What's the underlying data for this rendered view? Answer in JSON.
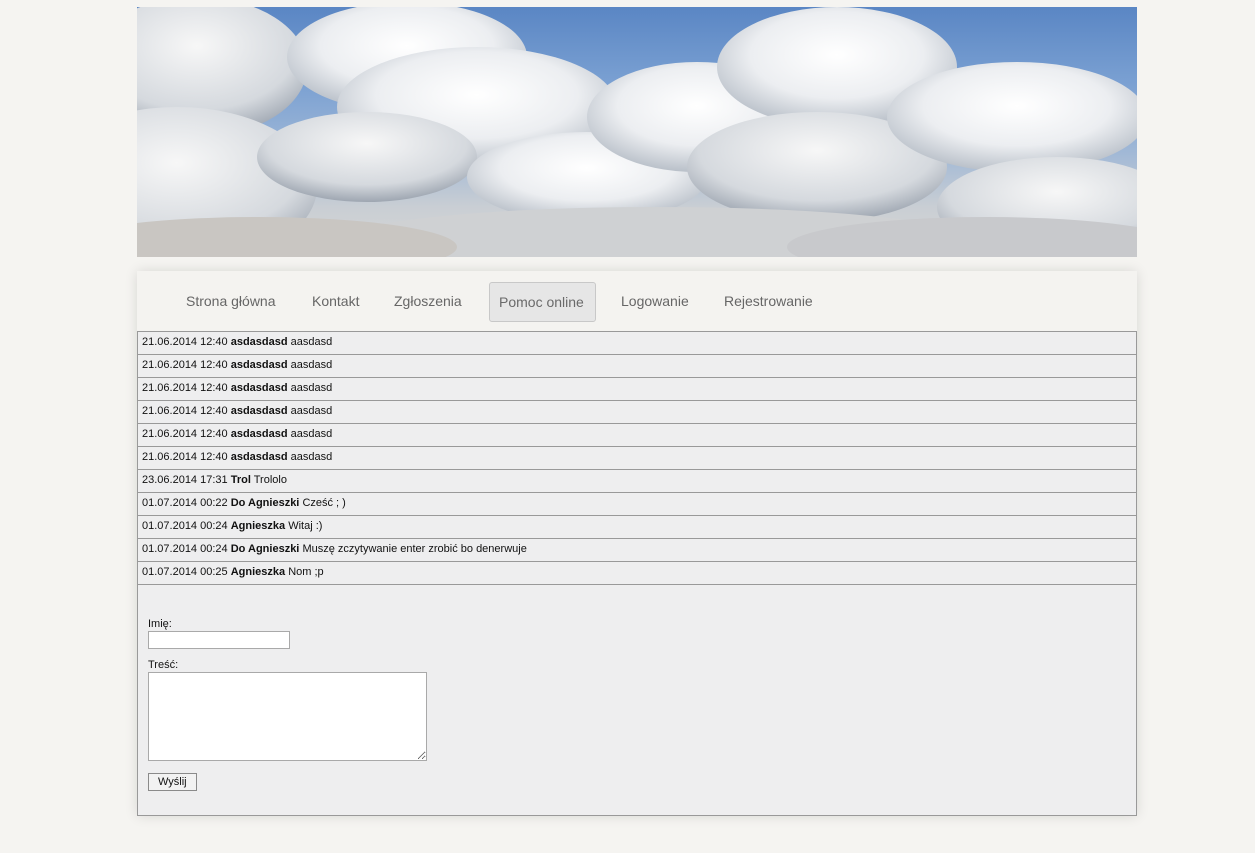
{
  "nav": {
    "items": [
      {
        "label": "Strona główna",
        "active": false
      },
      {
        "label": "Kontakt",
        "active": false
      },
      {
        "label": "Zgłoszenia",
        "active": false
      },
      {
        "label": "Pomoc online",
        "active": true
      },
      {
        "label": "Logowanie",
        "active": false
      },
      {
        "label": "Rejestrowanie",
        "active": false
      }
    ]
  },
  "messages": [
    {
      "datetime": "21.06.2014 12:40",
      "author": "asdasdasd",
      "text": "aasdasd"
    },
    {
      "datetime": "21.06.2014 12:40",
      "author": "asdasdasd",
      "text": "aasdasd"
    },
    {
      "datetime": "21.06.2014 12:40",
      "author": "asdasdasd",
      "text": "aasdasd"
    },
    {
      "datetime": "21.06.2014 12:40",
      "author": "asdasdasd",
      "text": "aasdasd"
    },
    {
      "datetime": "21.06.2014 12:40",
      "author": "asdasdasd",
      "text": "aasdasd"
    },
    {
      "datetime": "21.06.2014 12:40",
      "author": "asdasdasd",
      "text": "aasdasd"
    },
    {
      "datetime": "23.06.2014 17:31",
      "author": "Trol",
      "text": "Trololo"
    },
    {
      "datetime": "01.07.2014 00:22",
      "author": "Do Agnieszki",
      "text": "Cześć ; )"
    },
    {
      "datetime": "01.07.2014 00:24",
      "author": "Agnieszka",
      "text": "Witaj :)"
    },
    {
      "datetime": "01.07.2014 00:24",
      "author": "Do Agnieszki",
      "text": "Muszę zczytywanie enter zrobić bo denerwuje"
    },
    {
      "datetime": "01.07.2014 00:25",
      "author": "Agnieszka",
      "text": "Nom ;p"
    }
  ],
  "form": {
    "name_label": "Imię:",
    "name_value": "",
    "body_label": "Treść:",
    "body_value": "",
    "submit_label": "Wyślij"
  }
}
